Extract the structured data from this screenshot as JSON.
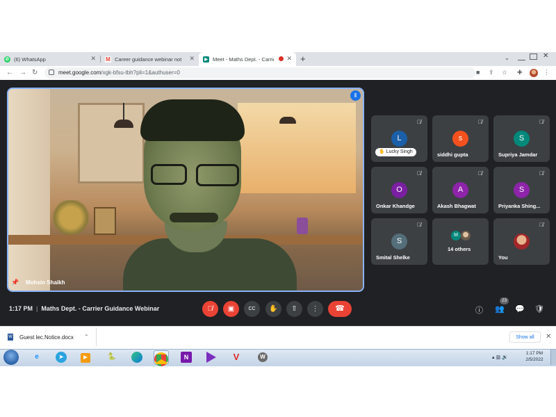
{
  "browser": {
    "tabs": [
      {
        "title": "(6) WhatsApp",
        "icon": "whatsapp-icon",
        "color": "#25d366",
        "active": false
      },
      {
        "title": "Career guidance webinar notice",
        "icon": "gmail-icon",
        "color": "#ea4335",
        "active": false
      },
      {
        "title": "Meet - Maths Dept. - Carrie",
        "icon": "meet-icon",
        "color": "#00897b",
        "active": true
      }
    ],
    "new_tab": "+",
    "url_host": "meet.google.com",
    "url_path": "/xgk-bfsu-tbh?pli=1&authuser=0"
  },
  "meet": {
    "main_speaker": "Mohsin Shaikh",
    "time": "1:17 PM",
    "meeting_title": "Maths Dept. - Carrier Guidance Webinar",
    "participant_count": "23",
    "participants": [
      {
        "name": "Lucky Singh",
        "initial": "L",
        "color": "#1a5fa8",
        "highlight": true
      },
      {
        "name": "siddhi gupta",
        "initial": "s",
        "color": "#f4511e"
      },
      {
        "name": "Supriya Jamdar",
        "initial": "S",
        "color": "#00897b"
      },
      {
        "name": "Onkar Khandge",
        "initial": "O",
        "color": "#7b1fa2"
      },
      {
        "name": "Akash Bhagwat",
        "initial": "A",
        "color": "#8e24aa"
      },
      {
        "name": "Priyanka Shing...",
        "initial": "S",
        "color": "#8e24aa"
      },
      {
        "name": "Smital Shelke",
        "initial": "S",
        "color": "#546e7a"
      },
      {
        "name": "14 others",
        "initial": "M",
        "color": "#00897b"
      },
      {
        "name": "You",
        "initial": "",
        "color": "#b71c1c"
      }
    ],
    "accent": "#1a73e8",
    "danger": "#ea4335"
  },
  "downloads": {
    "file": "Guest lec.Notice.docx",
    "show_all": "Show all"
  },
  "taskbar": {
    "time": "1:17 PM",
    "date": "2/5/2022"
  }
}
